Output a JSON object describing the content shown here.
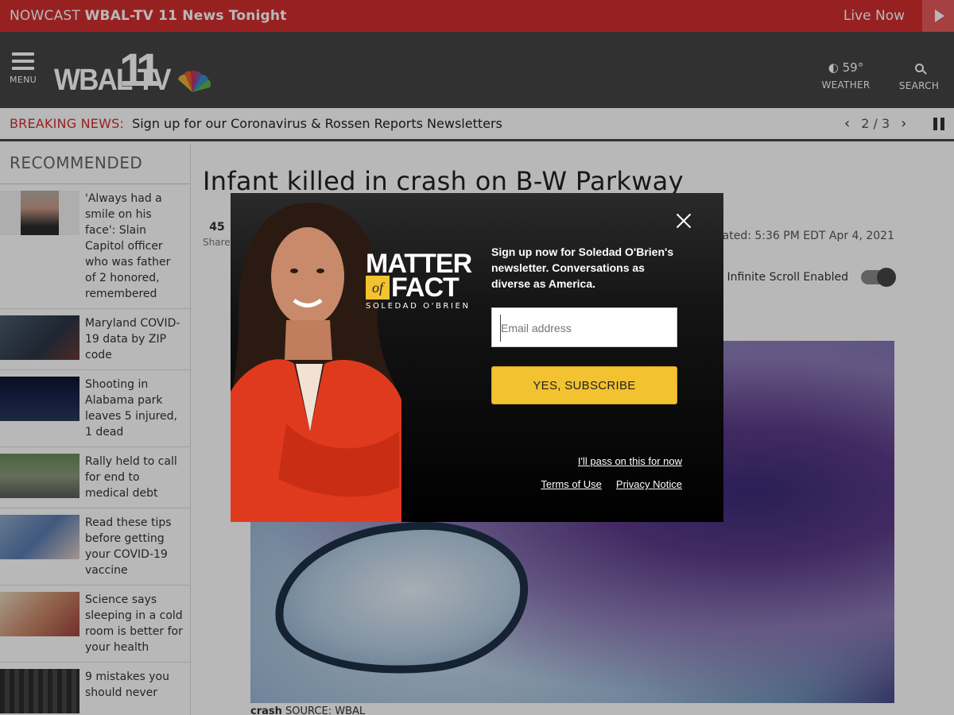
{
  "nowcast": {
    "prefix": "NOWCAST",
    "title": "WBAL-TV 11 News Tonight",
    "live_label": "Live Now"
  },
  "header": {
    "menu_label": "MENU",
    "logo_text": "WBAL TV",
    "logo_number": "11",
    "weather": {
      "temp": "59°",
      "label": "WEATHER"
    },
    "search_label": "SEARCH"
  },
  "breaking": {
    "label": "BREAKING NEWS:",
    "text": "Sign up for our Coronavirus & Rossen Reports Newsletters",
    "pager": "2 / 3"
  },
  "sidebar": {
    "heading": "RECOMMENDED",
    "items": [
      {
        "title": "'Always had a smile on his face': Slain Capitol officer who was father of 2 honored, remembered"
      },
      {
        "title": "Maryland COVID-19 data by ZIP code"
      },
      {
        "title": "Shooting in Alabama park leaves 5 injured, 1 dead"
      },
      {
        "title": "Rally held to call for end to medical debt"
      },
      {
        "title": "Read these tips before getting your COVID-19 vaccine"
      },
      {
        "title": "Science says sleeping in a cold room is better for your health"
      },
      {
        "title": "9 mistakes you should never"
      }
    ]
  },
  "article": {
    "title": "Infant killed in crash on B-W Parkway",
    "shares_count": "45",
    "shares_label": "Shares",
    "updated": "Updated: 5:36 PM EDT Apr 4, 2021",
    "infinite_scroll": "Infinite Scroll Enabled",
    "caption_bold": "crash",
    "caption_source": "SOURCE: WBAL"
  },
  "modal": {
    "logo_matter": "MATTER",
    "logo_of": "of",
    "logo_fact": "FACT",
    "logo_byline": "SOLEDAD O'BRIEN",
    "prompt": "Sign up now for Soledad O'Brien's newsletter. Conversations as diverse as America.",
    "email_placeholder": "Email address",
    "subscribe_label": "YES, SUBSCRIBE",
    "pass_label": "I'll pass on this for now",
    "terms_label": "Terms of Use",
    "privacy_label": "Privacy Notice"
  },
  "colors": {
    "brand_red": "#d22e2e",
    "header_gray": "#444444",
    "subscribe_yellow": "#f2c230"
  }
}
